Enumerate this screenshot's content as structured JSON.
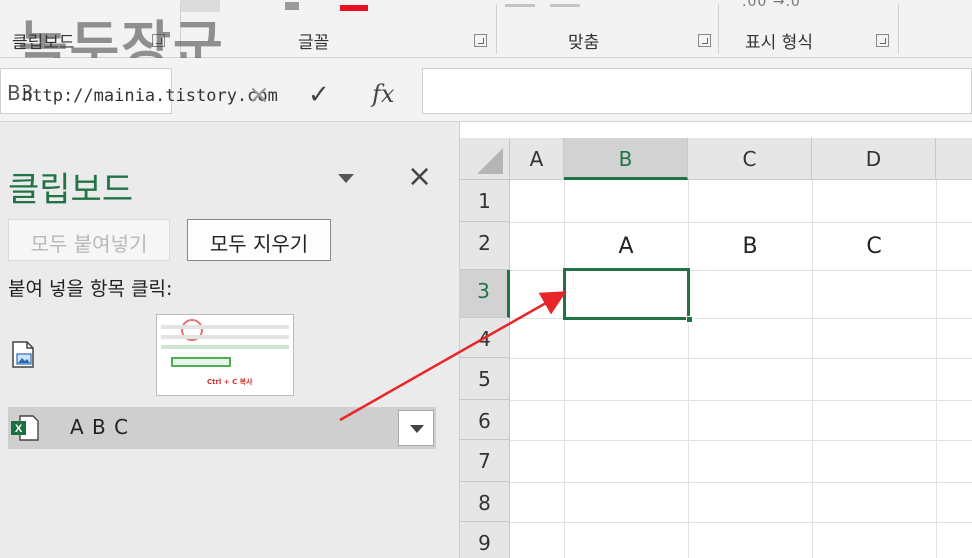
{
  "watermark": {
    "title": "녹두장군",
    "url": "http://mainia.tistory.com"
  },
  "ribbon": {
    "groups": [
      {
        "label": "클립보드"
      },
      {
        "label": "글꼴"
      },
      {
        "label": "맞춤"
      },
      {
        "label": "표시 형식"
      }
    ],
    "number_format_glyph": ".00 →.0",
    "accent_red": "#e81123"
  },
  "formula_bar": {
    "name_box": "B3",
    "cancel_icon": "×",
    "enter_icon": "✓",
    "fx_label": "fx",
    "value": ""
  },
  "clipboard_pane": {
    "title": "클립보드",
    "close_glyph": "×",
    "paste_all_label": "모두 붙여넣기",
    "clear_all_label": "모두 지우기",
    "hint": "붙여 넣을 항목 클릭:",
    "items": [
      {
        "type": "image",
        "icon": "picture-clip-icon",
        "thumb_caption": "Ctrl + C 복사"
      },
      {
        "type": "excel",
        "icon": "excel-clip-icon",
        "text": "A B C"
      }
    ]
  },
  "grid": {
    "columns": [
      "A",
      "B",
      "C",
      "D"
    ],
    "rows": [
      "1",
      "2",
      "3",
      "4",
      "5",
      "6",
      "7",
      "8",
      "9"
    ],
    "active_column": "B",
    "active_row": "3",
    "cells": {
      "B2": "A",
      "C2": "B",
      "D2": "C"
    }
  },
  "colors": {
    "excel_green": "#217346",
    "annotation_arrow": "#e8262a"
  }
}
